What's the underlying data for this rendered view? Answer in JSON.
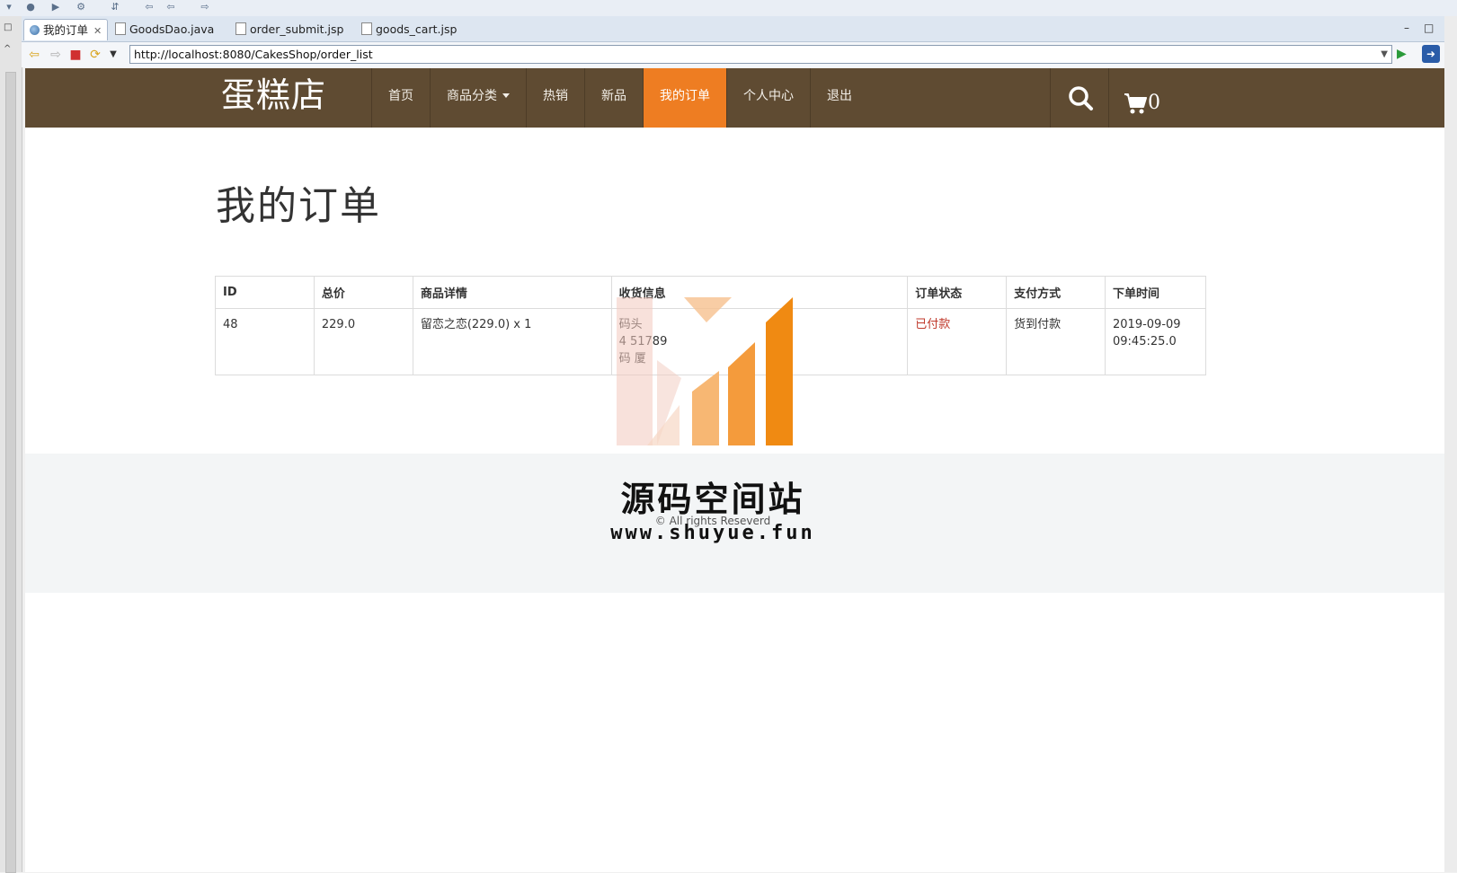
{
  "browser": {
    "tabs": [
      {
        "label": "我的订单",
        "icon": "globe-icon",
        "active": true
      },
      {
        "label": "GoodsDao.java",
        "icon": "java-file-icon"
      },
      {
        "label": "order_submit.jsp",
        "icon": "jsp-file-icon"
      },
      {
        "label": "goods_cart.jsp",
        "icon": "jsp-file-icon"
      }
    ],
    "url": "http://localhost:8080/CakesShop/order_list"
  },
  "site": {
    "brand": "蛋糕店",
    "nav": [
      "首页",
      "商品分类",
      "热销",
      "新品",
      "我的订单",
      "个人中心",
      "退出"
    ],
    "cart_count": "0",
    "header_color": "#5f4b32",
    "accent_color": "#ee7d22"
  },
  "page": {
    "title": "我的订单",
    "table": {
      "headers": [
        "ID",
        "总价",
        "商品详情",
        "收货信息",
        "订单状态",
        "支付方式",
        "下单时间"
      ],
      "rows": [
        {
          "id": "48",
          "total": "229.0",
          "detail": "留恋之恋(229.0) x 1",
          "shipping": [
            "码头",
            "4 51789",
            "码 厦"
          ],
          "status": "已付款",
          "payment": "货到付款",
          "time": [
            "2019-09-09",
            "09:45:25.0"
          ]
        }
      ]
    }
  },
  "footer": {
    "copyright": "© All rights Reseverd"
  },
  "watermark": {
    "name": "源码空间站",
    "url": "www.shuyue.fun"
  }
}
